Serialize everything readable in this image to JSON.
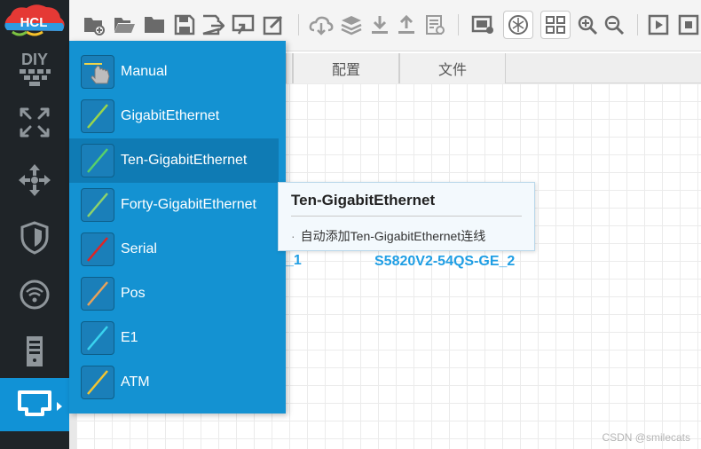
{
  "app": {
    "logo_text": "HCL"
  },
  "sidebar": {
    "items": [
      {
        "name": "diy",
        "label": "DIY"
      },
      {
        "name": "router",
        "label": ""
      },
      {
        "name": "switch",
        "label": ""
      },
      {
        "name": "security",
        "label": ""
      },
      {
        "name": "wireless",
        "label": ""
      },
      {
        "name": "server",
        "label": ""
      },
      {
        "name": "link",
        "label": ""
      }
    ]
  },
  "toolbar": {
    "icons": [
      "new-project-icon",
      "open-project-icon",
      "folder-icon",
      "save-icon",
      "save-as-icon",
      "export-icon",
      "edit-icon",
      "cloud-icon",
      "layers-icon",
      "download-icon",
      "upload-icon",
      "log-icon",
      "capture-icon",
      "topology-icon",
      "grid-icon",
      "zoom-in-icon",
      "zoom-out-icon",
      "play-icon",
      "stop-icon"
    ]
  },
  "tabs": [
    {
      "label": ""
    },
    {
      "label": "配置"
    },
    {
      "label": "文件"
    }
  ],
  "link_menu": {
    "items": [
      {
        "label": "Manual",
        "color": "#f1d54a"
      },
      {
        "label": "GigabitEthernet",
        "color": "#9ad64b"
      },
      {
        "label": "Ten-GigabitEthernet",
        "color": "#57d16a"
      },
      {
        "label": "Forty-GigabitEthernet",
        "color": "#8ed36b"
      },
      {
        "label": "Serial",
        "color": "#e02424"
      },
      {
        "label": "Pos",
        "color": "#e8a25a"
      },
      {
        "label": "E1",
        "color": "#39d3ef"
      },
      {
        "label": "ATM",
        "color": "#f4c531"
      }
    ],
    "hovered_index": 2
  },
  "tooltip": {
    "title": "Ten-GigabitEthernet",
    "description": "自动添加Ten-GigabitEthernet连线"
  },
  "devices": [
    {
      "label": "_1"
    },
    {
      "label": "S5820V2-54QS-GE_2"
    }
  ],
  "watermark": "CSDN @smilecats"
}
